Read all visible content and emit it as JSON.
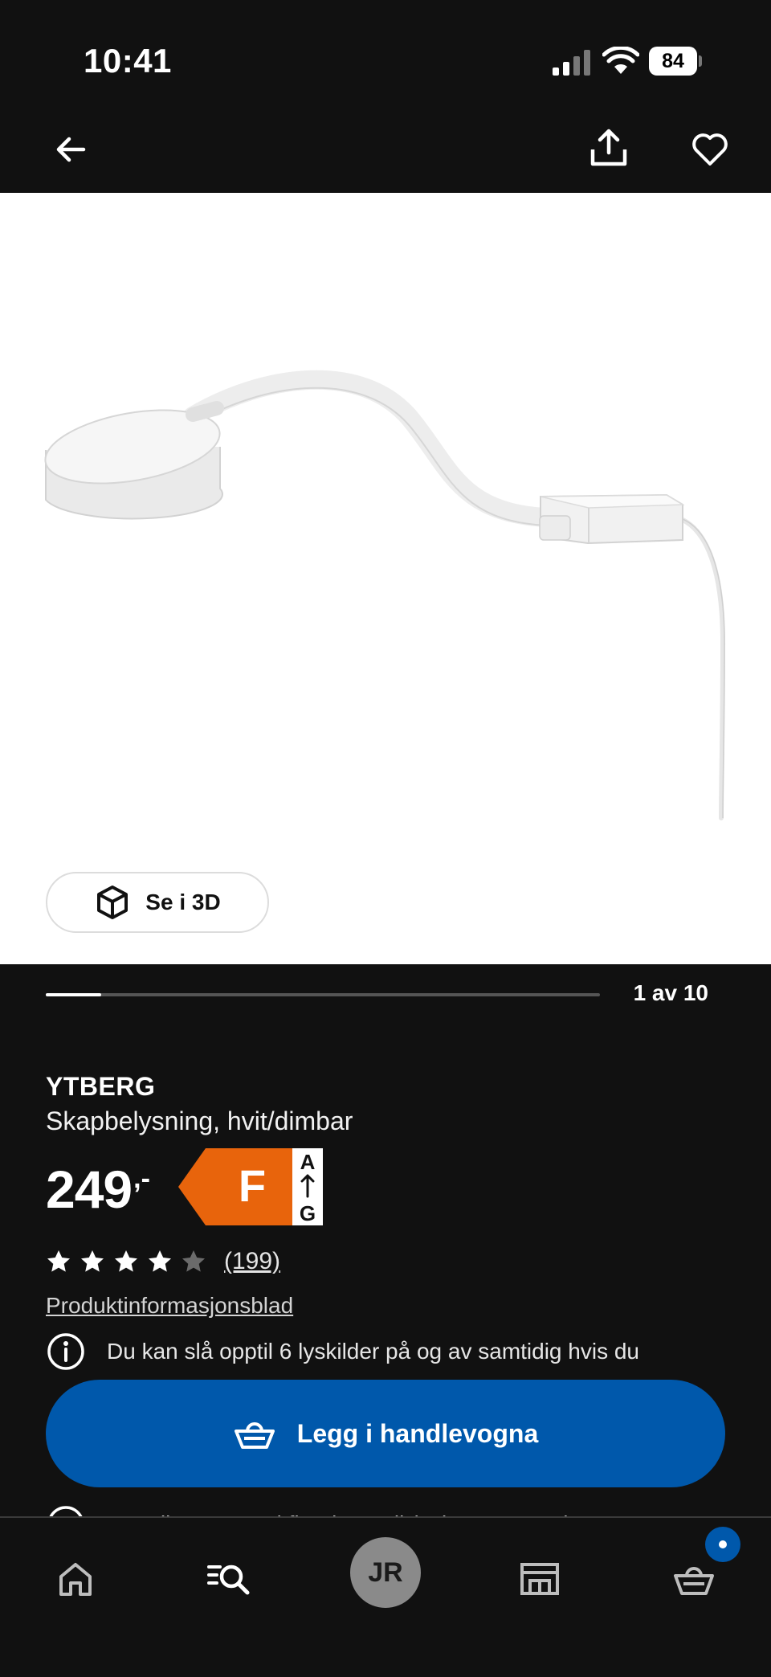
{
  "status_bar": {
    "time": "10:41",
    "battery": "84"
  },
  "product_gallery": {
    "see_3d_label": "Se i 3D",
    "counter": "1 av 10",
    "progress": 0.1
  },
  "product": {
    "name": "YTBERG",
    "description": "Skapbelysning, hvit/dimbar",
    "price": "249",
    "price_suffix": ",-",
    "energy_class": "F",
    "energy_scale_top": "A",
    "energy_scale_bottom": "G",
    "energy_color": "#e8640c",
    "rating": 4,
    "rating_max": 5,
    "review_count": "(199)",
    "info_sheet_link": "Produktinformasjonsblad",
    "info_notice": "Du kan slå opptil 6 lyskilder på og av samtidig hvis du",
    "partial_notice": "Kan dimmes med fjernkontroll (selges separat)"
  },
  "cta": {
    "add_to_cart_label": "Legg i handlevogna",
    "color": "#0058ab"
  },
  "bottom_nav": {
    "avatar_initials": "JR",
    "items": [
      "home-icon",
      "search-icon",
      "avatar",
      "store-icon",
      "cart-icon"
    ]
  }
}
